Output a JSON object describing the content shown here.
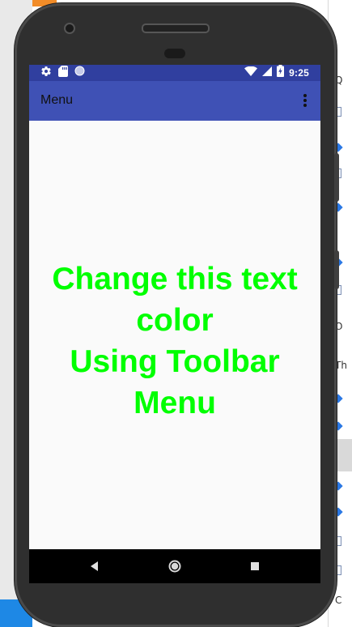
{
  "toolbar": {
    "title": "Menu"
  },
  "status_bar": {
    "time": "9:25"
  },
  "content": {
    "line1": "Change this text",
    "line2": "color",
    "line3": "Using Toolbar",
    "line4": "Menu"
  },
  "icons": {
    "settings": "gear-icon",
    "sd_card": "sd-card-icon",
    "notification_dot": "circle-icon",
    "wifi": "wifi-icon",
    "signal": "cellular-signal-icon",
    "battery": "battery-icon",
    "overflow": "more-vert-icon",
    "back": "back-icon",
    "home": "home-icon",
    "recents": "recents-icon"
  },
  "colors": {
    "status_bar": "#303f9f",
    "toolbar": "#3f51b5",
    "content_background": "#fafafa",
    "text": "#00ff00",
    "nav_bar": "#000000"
  }
}
